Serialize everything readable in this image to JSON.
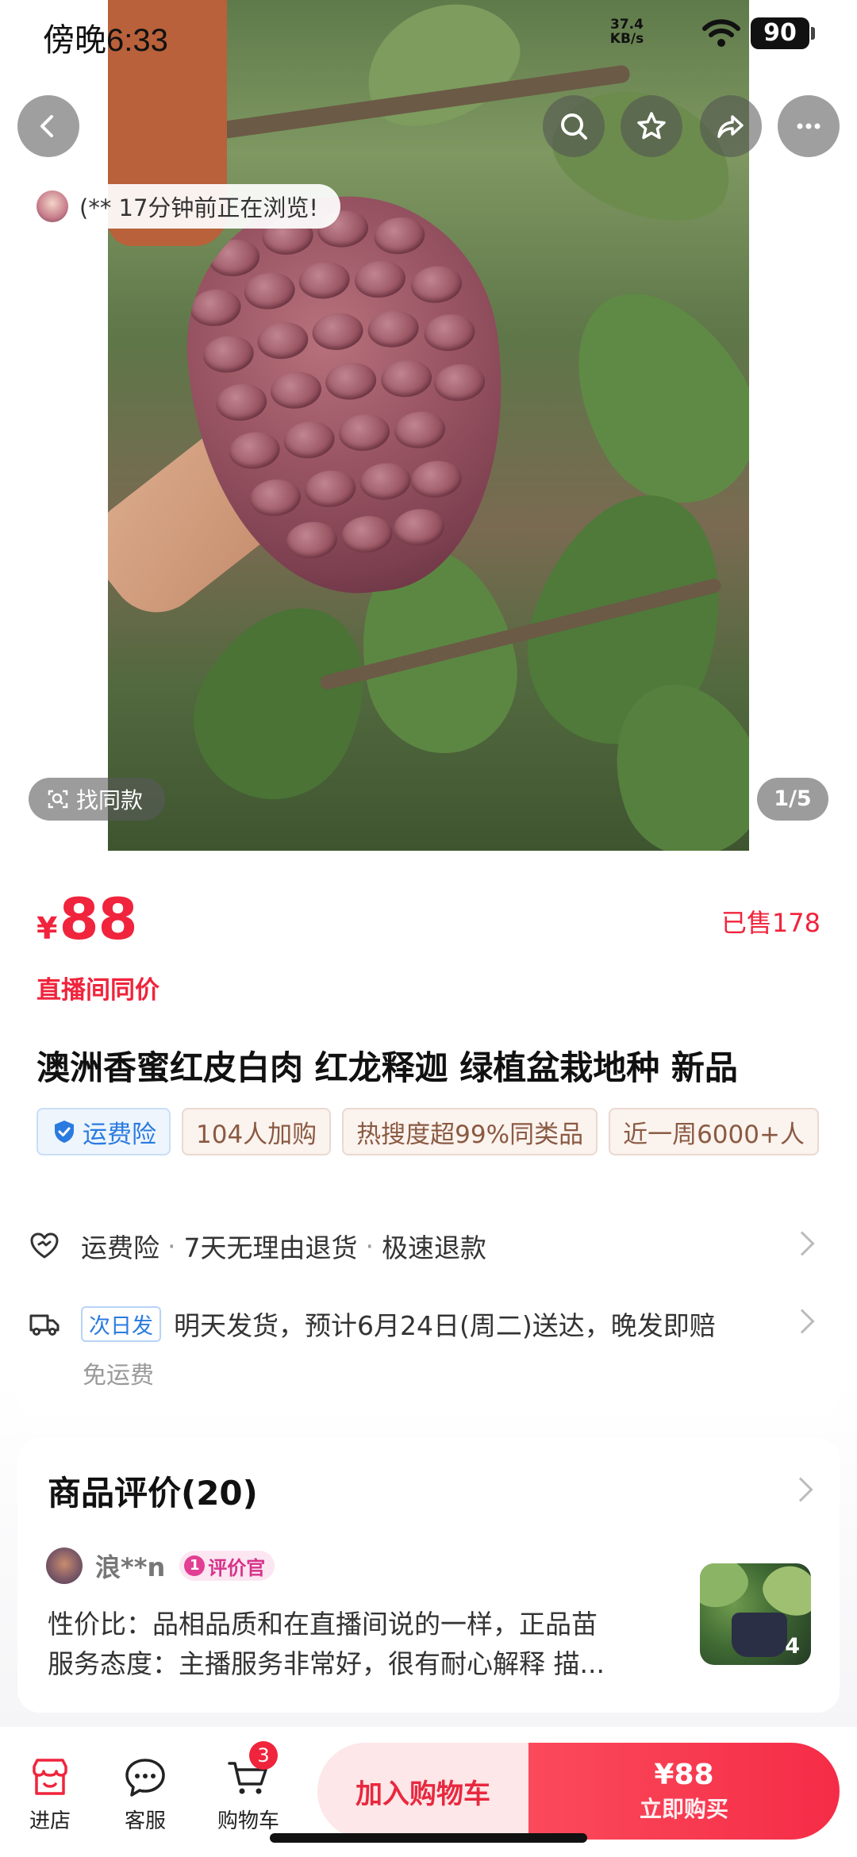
{
  "status_bar": {
    "time": "傍晚6:33",
    "net_speed_value": "37.4",
    "net_speed_unit": "KB/s",
    "battery": "90"
  },
  "top_actions": {
    "back_icon": "chevron-left-icon",
    "search_icon": "search-icon",
    "favorite_icon": "star-icon",
    "share_icon": "share-icon",
    "more_icon": "more-icon"
  },
  "gallery": {
    "browse_notice": "(** 17分钟前正在浏览!",
    "find_same_label": "找同款",
    "page_indicator": "1/5"
  },
  "product": {
    "currency": "¥",
    "price": "88",
    "sold": "已售178",
    "live_price_label": "直播间同价",
    "title": "澳洲香蜜红皮白肉 红龙释迦 绿植盆栽地种 新品",
    "tags": [
      "运费险",
      "104人加购",
      "热搜度超99%同类品",
      "近一周6000+人"
    ]
  },
  "service": {
    "guarantee_items": [
      "运费险",
      "7天无理由退货",
      "极速退款"
    ],
    "dot": "·",
    "next_day_tag": "次日发",
    "delivery_text": "明天发货，预计6月24日(周二)送达，晚发即赔",
    "free_shipping": "免运费"
  },
  "reviews": {
    "title": "商品评价(20)",
    "user_name": "浪**n",
    "badge_num": "1",
    "badge_label": "评价官",
    "line1": "性价比：品相品质和在直播间说的一样，正品苗",
    "line2": "服务态度：主播服务非常好，很有耐心解释 描...",
    "photo_count": "4"
  },
  "bottom_bar": {
    "store_label": "进店",
    "service_label": "客服",
    "cart_label": "购物车",
    "cart_count": "3",
    "add_to_cart_label": "加入购物车",
    "buy_price": "¥88",
    "buy_now_label": "立即购买"
  },
  "colors": {
    "accent_red": "#f0243c",
    "tag_blue": "#2a7be0",
    "tag_brown": "#8a5a43",
    "badge_pink": "#d6338a"
  }
}
